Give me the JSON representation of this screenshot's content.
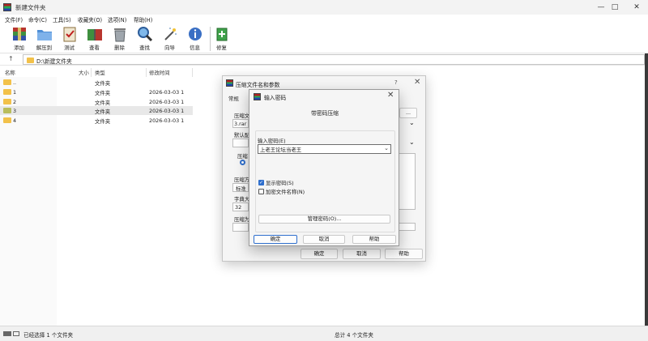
{
  "window": {
    "title": "新建文件夹"
  },
  "menu": [
    "文件(F)",
    "命令(C)",
    "工具(S)",
    "收藏夹(O)",
    "选项(N)",
    "帮助(H)"
  ],
  "toolbar": [
    {
      "label": "添加",
      "icon": "add-archive-icon"
    },
    {
      "label": "解压到",
      "icon": "extract-folder-icon"
    },
    {
      "label": "测试",
      "icon": "test-clipboard-icon"
    },
    {
      "label": "查看",
      "icon": "view-book-icon"
    },
    {
      "label": "删除",
      "icon": "trash-icon"
    },
    {
      "label": "查找",
      "icon": "magnifier-icon"
    },
    {
      "label": "向导",
      "icon": "wizard-wand-icon"
    },
    {
      "label": "信息",
      "icon": "info-icon"
    },
    {
      "label": "修复",
      "icon": "repair-kit-icon"
    }
  ],
  "address": {
    "path": "D:\\新建文件夹"
  },
  "columns": [
    "名称",
    "大小",
    "类型",
    "修改时间"
  ],
  "files": [
    {
      "name": "..",
      "type": "文件夹",
      "modified": ""
    },
    {
      "name": "1",
      "type": "文件夹",
      "modified": "2026-03-03 1"
    },
    {
      "name": "2",
      "type": "文件夹",
      "modified": "2026-03-03 1"
    },
    {
      "name": "3",
      "type": "文件夹",
      "modified": "2026-03-03 1"
    },
    {
      "name": "4",
      "type": "文件夹",
      "modified": "2026-03-03 1"
    }
  ],
  "status": {
    "selected": "已经选择 1 个文件夹",
    "total": "总计 4 个文件夹"
  },
  "archive_dialog": {
    "title": "压缩文件名和参数",
    "help": "?",
    "tab": "常规",
    "labels": {
      "archive_name": "压缩文",
      "default_profile": "默认配",
      "format": "压缩",
      "method": "压缩方",
      "dict": "字典大",
      "volume": "压缩为"
    },
    "archive_name_value": "3.rar",
    "browse_label": "...",
    "method_value": "标准",
    "dict_value": "32",
    "buttons": {
      "ok": "确定",
      "cancel": "取消",
      "help": "帮助"
    }
  },
  "password_dialog": {
    "title": "输入密码",
    "heading": "带密码压缩",
    "enter_label": "输入密码(E)",
    "password_value": "上老王论坛当老王",
    "show_password": {
      "label": "显示密码(S)",
      "checked": true
    },
    "encrypt_names": {
      "label": "加密文件名称(N)",
      "checked": false
    },
    "manage_label": "管理密码(O)...",
    "buttons": {
      "ok": "确定",
      "cancel": "取消",
      "help": "帮助"
    }
  }
}
